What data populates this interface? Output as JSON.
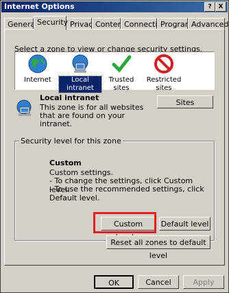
{
  "window": {
    "title": "Internet Options",
    "help_glyph": "?",
    "close_glyph": "X"
  },
  "tabs": [
    {
      "label": "General"
    },
    {
      "label": "Security"
    },
    {
      "label": "Privacy"
    },
    {
      "label": "Content"
    },
    {
      "label": "Connections"
    },
    {
      "label": "Programs"
    },
    {
      "label": "Advanced"
    }
  ],
  "security": {
    "instruction": "Select a zone to view or change security settings.",
    "zones": [
      {
        "label": "Internet",
        "icon": "globe-icon"
      },
      {
        "label": "Local intranet",
        "icon": "computer-network-icon",
        "selected": true
      },
      {
        "label": "Trusted sites",
        "icon": "checkmark-icon"
      },
      {
        "label": "Restricted sites",
        "icon": "no-entry-icon"
      }
    ],
    "zone_info": {
      "title": "Local intranet",
      "description": "This zone is for all websites that are found on your intranet.",
      "sites_button": "Sites"
    },
    "level_group": {
      "title": "Security level for this zone",
      "level_name": "Custom",
      "line1": "Custom settings.",
      "line2": "- To change the settings, click Custom level.",
      "line3": "- To use the recommended settings, click Default level."
    },
    "custom_level_button": "Custom level...",
    "default_level_button": "Default level",
    "reset_all_button": "Reset all zones to default level"
  },
  "footer": {
    "ok": "OK",
    "cancel": "Cancel",
    "apply": "Apply"
  },
  "colors": {
    "titlebar": "#0a246a",
    "highlight": "#e02020",
    "selection": "#0a246a"
  }
}
